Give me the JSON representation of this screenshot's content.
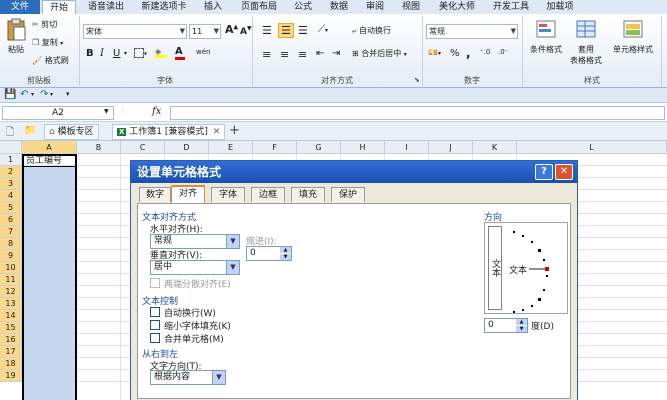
{
  "menu_tabs": [
    "文件",
    "开始",
    "语音读出",
    "新建选项卡",
    "插入",
    "页面布局",
    "公式",
    "数据",
    "审阅",
    "视图",
    "美化大师",
    "开发工具",
    "加载项"
  ],
  "ribbon": {
    "clipboard": {
      "paste": "粘贴",
      "cut": "剪切",
      "copy": "复制",
      "format_painter": "格式刷",
      "label": "剪贴板"
    },
    "font": {
      "name": "宋体",
      "size": "11",
      "bold": "B",
      "italic": "I",
      "underline": "U",
      "grow": "A",
      "shrink": "A",
      "font_color": "A",
      "wen": "wén",
      "label": "字体"
    },
    "alignment": {
      "wrap": "自动换行",
      "merge": "合并后居中",
      "label": "对齐方式"
    },
    "number": {
      "format": "常规",
      "percent": "%",
      "comma": ",",
      "label": "数字"
    },
    "styles": {
      "cond": "条件格式",
      "table": "套用",
      "table2": "表格格式",
      "cell": "单元格样式",
      "label": "样式"
    }
  },
  "name_box": "A2",
  "fx": "fx",
  "doc_tabs": {
    "template": "模板专区",
    "workbook": "工作簿1 [兼容模式]",
    "add": "+"
  },
  "columns": [
    "A",
    "B",
    "C",
    "D",
    "E",
    "F",
    "G",
    "H",
    "I",
    "J",
    "K",
    "L"
  ],
  "rows": [
    "1",
    "2",
    "3",
    "4",
    "5",
    "6",
    "7",
    "8",
    "9",
    "10",
    "11",
    "12",
    "13",
    "14",
    "15",
    "16",
    "17",
    "18",
    "19"
  ],
  "cell_a1": "员工编号",
  "dialog": {
    "title": "设置单元格格式",
    "help": "?",
    "close": "✕",
    "tabs": [
      "数字",
      "对齐",
      "字体",
      "边框",
      "填充",
      "保护"
    ],
    "text_align": {
      "section": "文本对齐方式",
      "h_label": "水平对齐(H):",
      "h_value": "常规",
      "indent_label": "缩进(I):",
      "indent_value": "0",
      "v_label": "垂直对齐(V):",
      "v_value": "居中",
      "distributed": "两端分散对齐(E)"
    },
    "text_control": {
      "section": "文本控制",
      "wrap": "自动换行(W)",
      "shrink": "缩小字体填充(K)",
      "merge": "合并单元格(M)"
    },
    "rtl": {
      "section": "从右到左",
      "dir_label": "文字方向(T):",
      "dir_value": "根据内容"
    },
    "orientation": {
      "section": "方向",
      "vertical_text": "文本",
      "horizontal_text": "文本",
      "degrees_value": "0",
      "degrees_label": "度(D)"
    }
  }
}
